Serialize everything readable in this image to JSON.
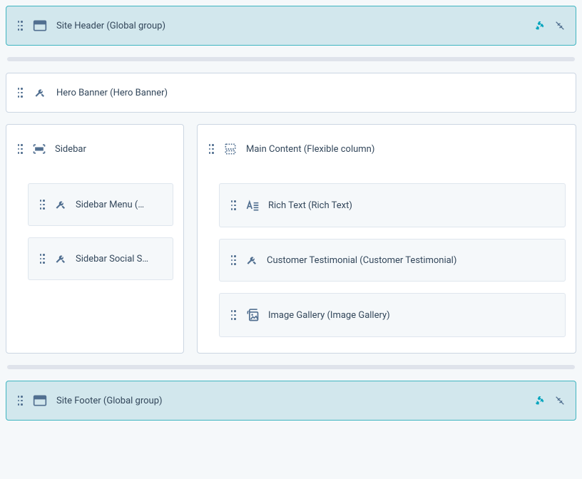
{
  "header": {
    "label": "Site Header (Global group)"
  },
  "hero": {
    "label": "Hero Banner (Hero Banner)"
  },
  "sidebar": {
    "label": "Sidebar",
    "items": [
      {
        "label": "Sidebar Menu (…"
      },
      {
        "label": "Sidebar Social S…"
      }
    ]
  },
  "main": {
    "label": "Main Content (Flexible column)",
    "items": [
      {
        "label": "Rich Text (Rich Text)"
      },
      {
        "label": "Customer Testimonial (Customer Testimonial)"
      },
      {
        "label": "Image Gallery (Image Gallery)"
      }
    ]
  },
  "footer": {
    "label": "Site Footer (Global group)"
  }
}
